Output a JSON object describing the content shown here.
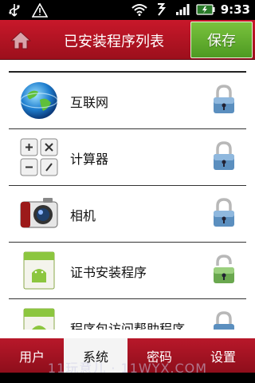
{
  "status_bar": {
    "time": "9:33",
    "icons": [
      "usb-icon",
      "warning-icon",
      "wifi-icon",
      "data-sync-icon",
      "signal-icon",
      "battery-icon"
    ]
  },
  "header": {
    "title": "已安装程序列表",
    "save_label": "保存",
    "home_icon": "home-icon"
  },
  "apps": [
    {
      "label": "互联网",
      "icon": "globe-icon",
      "lock": "locked"
    },
    {
      "label": "计算器",
      "icon": "calculator-icon",
      "lock": "locked"
    },
    {
      "label": "相机",
      "icon": "camera-icon",
      "lock": "locked"
    },
    {
      "label": "证书安装程序",
      "icon": "android-package-icon",
      "lock": "unlocked"
    },
    {
      "label": "程序包访问帮助程序",
      "icon": "android-package-icon",
      "lock": "locked"
    }
  ],
  "tabs": [
    {
      "label": "用户",
      "active": false
    },
    {
      "label": "系统",
      "active": true
    },
    {
      "label": "密码",
      "active": false
    },
    {
      "label": "设置",
      "active": false
    }
  ],
  "watermark": "11玩意儿 · 11WYX.COM",
  "colors": {
    "header_red": "#b0141f",
    "save_green": "#5faa2b",
    "lock_blue": "#5b8fbf",
    "lock_green": "#6aa84f"
  }
}
